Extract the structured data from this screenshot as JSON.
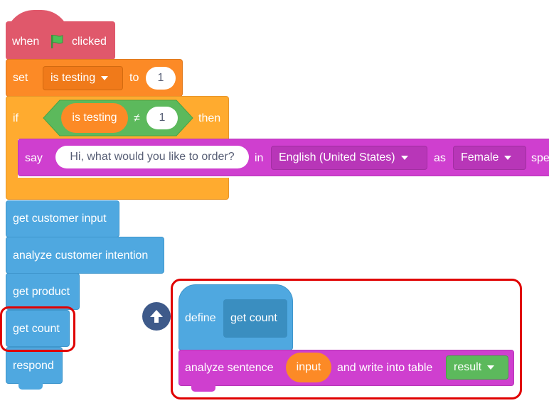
{
  "colors": {
    "events": "#e0586b",
    "variables": "#fc8a26",
    "control": "#ffab2f",
    "operators": "#5cb95c",
    "text2speech": "#cf3fcf",
    "myblocks": "#4fa8e0",
    "highlight": "#e00000",
    "scroll_button": "#3e5a8a"
  },
  "icons": {
    "flag": "green-flag-icon",
    "dropdown": "caret-down-icon",
    "scroll": "up-arrow-icon"
  },
  "script_main": {
    "hat": {
      "when": "when",
      "clicked": "clicked"
    },
    "set_block": {
      "set": "set",
      "variable": "is testing",
      "to": "to",
      "value": "1"
    },
    "if_block": {
      "if": "if",
      "left": "is testing",
      "op": "≠",
      "right": "1",
      "then": "then"
    },
    "say_block": {
      "say": "say",
      "text": "Hi, what would you like to order?",
      "in": "in",
      "language": "English (United States)",
      "as": "as",
      "voice": "Female",
      "trailing": "spe"
    },
    "steps": [
      "get customer input",
      "analyze customer intention",
      "get product",
      "get count",
      "respond"
    ]
  },
  "script_define": {
    "define": "define",
    "name": "get count",
    "analyze": {
      "prefix": "analyze sentence",
      "arg": "input",
      "middle": "and write into table",
      "table": "result"
    }
  }
}
